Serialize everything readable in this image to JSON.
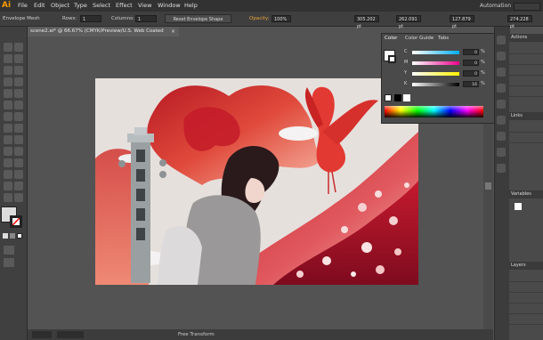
{
  "app": {
    "logo": "Ai",
    "menus": [
      "File",
      "Edit",
      "Object",
      "Type",
      "Select",
      "Effect",
      "View",
      "Window",
      "Help"
    ],
    "workspace": "Automation"
  },
  "control_bar": {
    "selection_label": "Envelope Mesh",
    "rows_label": "Rows:",
    "rows_value": "1",
    "columns_label": "Columns:",
    "columns_value": "1",
    "reset_button": "Reset Envelope Shape",
    "opacity_label": "Opacity:",
    "opacity_value": "100%",
    "x_value": "305.202 pt",
    "y_value": "262.091 pt",
    "w_value": "127.879 pt",
    "h_value": "274.228 pt"
  },
  "document": {
    "tab_title": "scene2.ai* @ 66.67% (CMYK/Preview/U.S. Web Coated (SWOP) v2)"
  },
  "color_panel": {
    "tabs": [
      "Color",
      "Color Guide",
      "Tabs"
    ],
    "sliders": [
      {
        "label": "C",
        "value": "0",
        "color": "cyan"
      },
      {
        "label": "M",
        "value": "0",
        "color": "magenta"
      },
      {
        "label": "Y",
        "value": "0",
        "color": "yellow"
      },
      {
        "label": "K",
        "value": "16",
        "color": "black"
      }
    ],
    "unit": "%"
  },
  "right_panel": {
    "actions_tab": "Actions",
    "links_tab": "Links",
    "variables_tab": "Variables",
    "layers_tab": "Layers"
  },
  "status": {
    "tool_hint": "Free Transform"
  },
  "colors": {
    "accent": "#ff9a00",
    "ui_dark": "#323232",
    "panel": "#4a4a4a",
    "artwork_red": "#c6202c"
  }
}
